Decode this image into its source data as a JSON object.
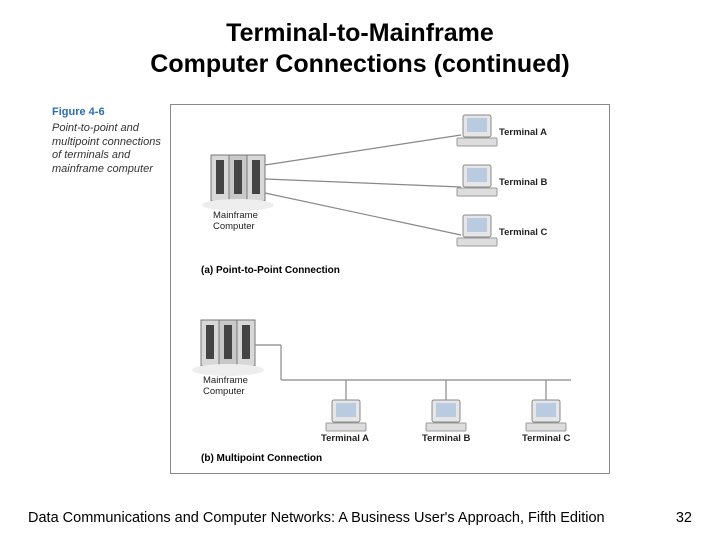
{
  "title_line1": "Terminal-to-Mainframe",
  "title_line2": "Computer Connections (continued)",
  "figure": {
    "label": "Figure 4-6",
    "caption": "Point-to-point and multipoint connections of terminals and mainframe computer"
  },
  "diagram_a": {
    "mainframe_label": "Mainframe",
    "mainframe_label2": "Computer",
    "terminal_a": "Terminal A",
    "terminal_b": "Terminal B",
    "terminal_c": "Terminal C",
    "caption": "(a) Point-to-Point Connection"
  },
  "diagram_b": {
    "mainframe_label": "Mainframe",
    "mainframe_label2": "Computer",
    "terminal_a": "Terminal A",
    "terminal_b": "Terminal B",
    "terminal_c": "Terminal C",
    "caption": "(b) Multipoint Connection"
  },
  "footer": {
    "text": "Data Communications and Computer Networks: A Business User's Approach, Fifth Edition",
    "page": "32"
  }
}
